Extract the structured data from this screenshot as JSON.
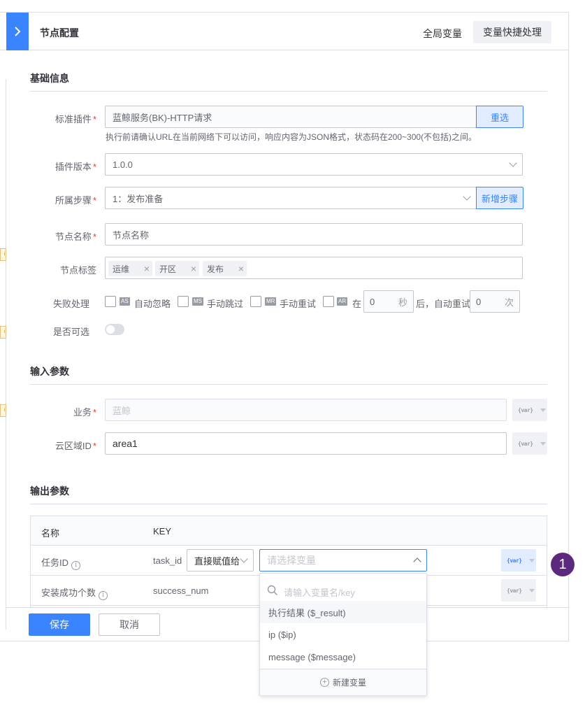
{
  "header": {
    "title": "节点配置",
    "global_vars": "全局变量",
    "quick_var": "变量快捷处理"
  },
  "basic": {
    "section_title": "基础信息",
    "plugin": {
      "label": "标准插件",
      "value": "蓝鲸服务(BK)-HTTP请求",
      "reselect": "重选",
      "hint": "执行前请确认URL在当前网络下可以访问，响应内容为JSON格式，状态码在200~300(不包括)之间。"
    },
    "version": {
      "label": "插件版本",
      "value": "1.0.0"
    },
    "step": {
      "label": "所属步骤",
      "value": "1：发布准备",
      "add_step": "新增步骤"
    },
    "node_name": {
      "label": "节点名称",
      "value": "节点名称"
    },
    "tags": {
      "label": "节点标签",
      "items": [
        "运维",
        "开区",
        "发布"
      ]
    },
    "failure": {
      "label": "失败处理",
      "options": [
        {
          "badge": "AS",
          "label": "自动忽略"
        },
        {
          "badge": "MS",
          "label": "手动跳过"
        },
        {
          "badge": "MR",
          "label": "手动重试"
        },
        {
          "badge": "AR",
          "label": "在"
        }
      ],
      "seconds_value": "0",
      "seconds_unit": "秒",
      "auto_retry_text": "后，自动重试",
      "times_value": "0",
      "times_unit": "次"
    },
    "optional": {
      "label": "是否可选",
      "enabled": false
    }
  },
  "input": {
    "section_title": "输入参数",
    "business": {
      "label": "业务",
      "placeholder": "蓝鲸"
    },
    "cloud": {
      "label": "云区域ID",
      "value": "area1"
    },
    "var_icon": "{var}"
  },
  "output": {
    "section_title": "输出参数",
    "columns": [
      "名称",
      "KEY"
    ],
    "rows": [
      {
        "name": "任务ID",
        "key": "task_id",
        "assign": "直接赋值给",
        "select_placeholder": "请选择变量"
      },
      {
        "name": "安装成功个数",
        "key": "success_num"
      }
    ]
  },
  "dropdown": {
    "search_placeholder": "请输入变量名/key",
    "items": [
      "执行结果 ($_result)",
      "ip ($ip)",
      "message ($message)"
    ],
    "new_var": "新建变量"
  },
  "footer": {
    "save": "保存",
    "cancel": "取消"
  },
  "step_marker": "1",
  "colors": {
    "primary": "#3a84ff",
    "required": "#ea3636",
    "marker": "#5b2a7e"
  }
}
